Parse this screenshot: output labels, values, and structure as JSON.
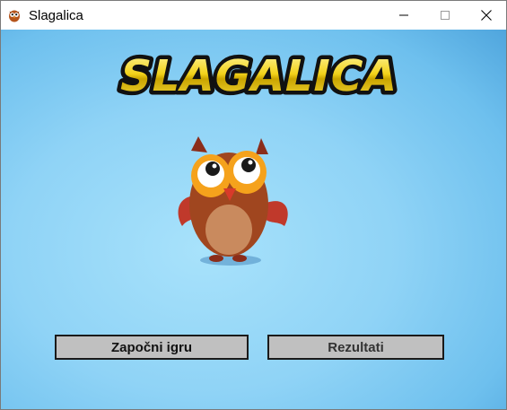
{
  "window": {
    "title": "Slagalica",
    "icon": "owl-app-icon",
    "controls": [
      "minimize-icon",
      "maximize-icon",
      "close-icon"
    ]
  },
  "main": {
    "logo_text": "SLAGALICA",
    "mascot": "owl-mascot",
    "buttons": {
      "start_label": "Započni igru",
      "results_label": "Rezultati"
    }
  },
  "colors": {
    "background_light": "#a8e2fb",
    "background_dark": "#2c7fc0",
    "logo_gold": "#f2d21a",
    "button_face": "#c0c0c0"
  }
}
